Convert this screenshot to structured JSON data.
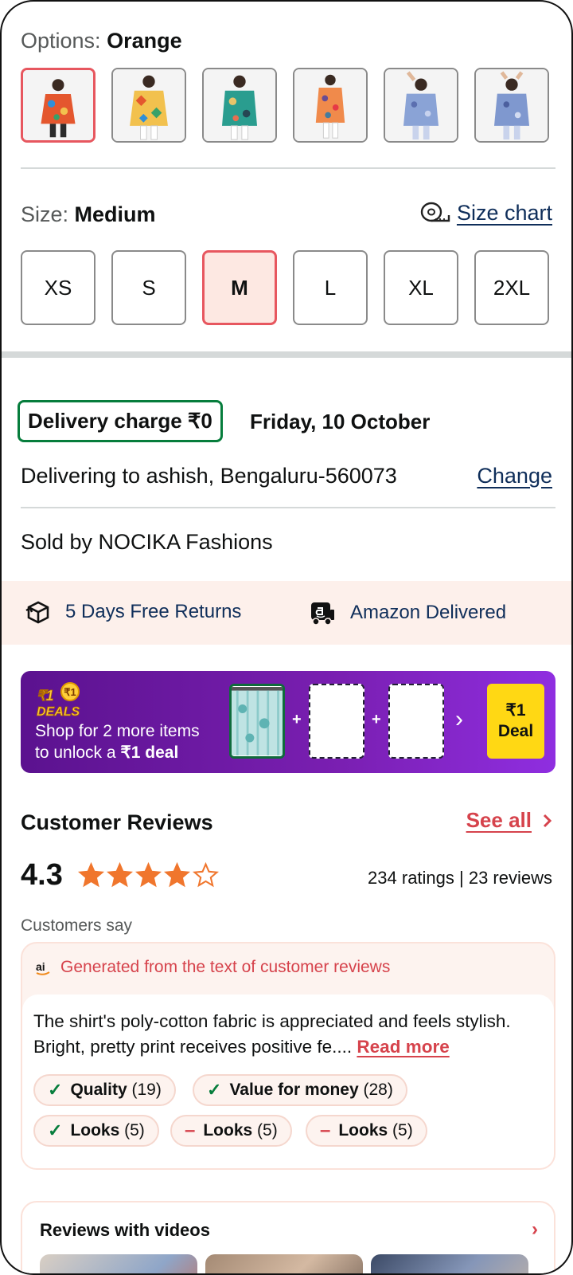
{
  "options": {
    "label": "Options: ",
    "selected": "Orange",
    "count": 6
  },
  "size": {
    "label": "Size: ",
    "selected": "Medium",
    "chart_link": "Size chart",
    "options": [
      "XS",
      "S",
      "M",
      "L",
      "XL",
      "2XL"
    ]
  },
  "delivery": {
    "charge_badge": "Delivery charge ₹0",
    "date": "Friday, 10 October",
    "deliver_to": "Delivering to ashish, Bengaluru-560073",
    "change_link": "Change"
  },
  "seller": {
    "sold_by": "Sold by NOCIKA Fashions"
  },
  "perks": {
    "returns": "5 Days Free Returns",
    "delivered": "Amazon Delivered"
  },
  "deal": {
    "logo_top": "₹1",
    "logo_bottom": "DEALS",
    "line1": "Shop for 2 more items",
    "line2_prefix": "to unlock a ",
    "line2_bold": "₹1 deal",
    "cta_top": "₹1",
    "cta_bottom": "Deal",
    "plus": "+"
  },
  "reviews": {
    "title": "Customer Reviews",
    "see_all": "See all",
    "rating": "4.3",
    "stars_filled": 4,
    "stars_total": 5,
    "counts": "234 ratings | 23 reviews",
    "customers_say": "Customers say",
    "ai_label": "Generated from the text of customer reviews",
    "ai_logo": "ai",
    "summary": "The shirt's poly-cotton fabric is appreciated and feels stylish. Bright, pretty print receives positive fe.... ",
    "read_more": "Read more",
    "chips": [
      {
        "name": "Quality",
        "count": "(19)",
        "sentiment": "positive"
      },
      {
        "name": "Value for money",
        "count": "(28)",
        "sentiment": "positive"
      },
      {
        "name": "Looks",
        "count": "(5)",
        "sentiment": "positive"
      },
      {
        "name": "Looks",
        "count": "(5)",
        "sentiment": "negative"
      },
      {
        "name": "Looks",
        "count": "(5)",
        "sentiment": "negative"
      }
    ]
  },
  "videos": {
    "title": "Reviews with videos"
  },
  "colors": {
    "accent": "#d6434c",
    "selected_border": "#e7575f",
    "selected_fill": "#fde8e2",
    "delivery_green": "#067d3c",
    "star": "#f0762d",
    "deal_purple": "#6a1aa3",
    "deal_yellow": "#ffd814"
  }
}
